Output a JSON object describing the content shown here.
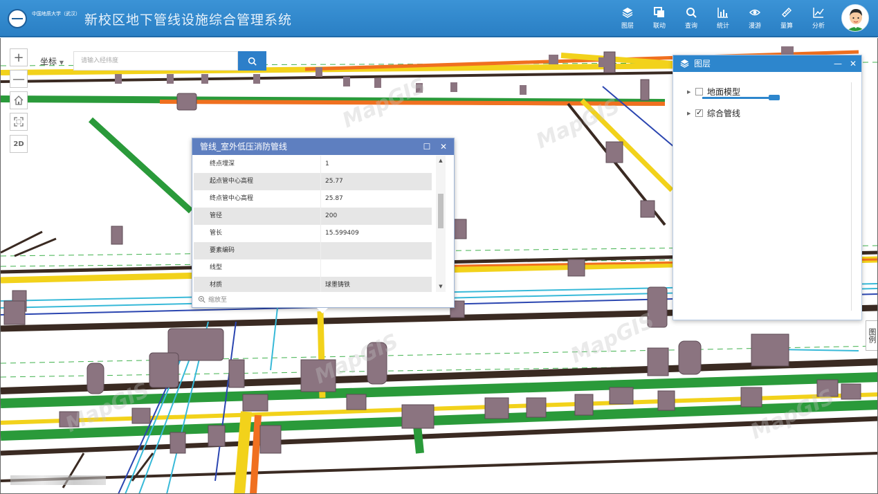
{
  "header": {
    "logo_subtitle": "中国地质大学（武汉）",
    "title": "新校区地下管线设施综合管理系统",
    "tools": [
      {
        "label": "图层",
        "icon": "layers-icon"
      },
      {
        "label": "联动",
        "icon": "link-windows-icon"
      },
      {
        "label": "查询",
        "icon": "search-icon"
      },
      {
        "label": "统计",
        "icon": "bar-chart-icon"
      },
      {
        "label": "漫游",
        "icon": "eye-icon"
      },
      {
        "label": "量算",
        "icon": "ruler-icon"
      },
      {
        "label": "分析",
        "icon": "line-chart-icon"
      }
    ]
  },
  "search": {
    "coord_label": "坐标",
    "placeholder": "请输入经纬度"
  },
  "nav": {
    "zoom_in": "+",
    "zoom_out": "—",
    "two_d": "2D"
  },
  "popup": {
    "title": "管线_室外低压消防管线",
    "rows": [
      {
        "k": "终点埋深",
        "v": "1"
      },
      {
        "k": "起点管中心高程",
        "v": "25.77"
      },
      {
        "k": "终点管中心高程",
        "v": "25.87"
      },
      {
        "k": "管径",
        "v": "200"
      },
      {
        "k": "管长",
        "v": "15.599409"
      },
      {
        "k": "要素编码",
        "v": ""
      },
      {
        "k": "线型",
        "v": ""
      },
      {
        "k": "材质",
        "v": "球墨铸铁"
      }
    ],
    "zoom_label": "缩放至"
  },
  "layers": {
    "title": "图层",
    "items": [
      {
        "label": "地面模型",
        "checked": false
      },
      {
        "label": "综合管线",
        "checked": true
      }
    ]
  },
  "legend": {
    "label": "图例"
  },
  "colors": {
    "header": "#2f87cb",
    "popup_header": "#5e7fc0",
    "pipe_yellow": "#f2d21b",
    "pipe_green": "#2a9a3a",
    "pipe_orange": "#f07020",
    "pipe_brown": "#3a2a22",
    "pipe_cyan": "#37b9d8",
    "pipe_blue": "#2a45b0",
    "well": "#8b7480"
  }
}
